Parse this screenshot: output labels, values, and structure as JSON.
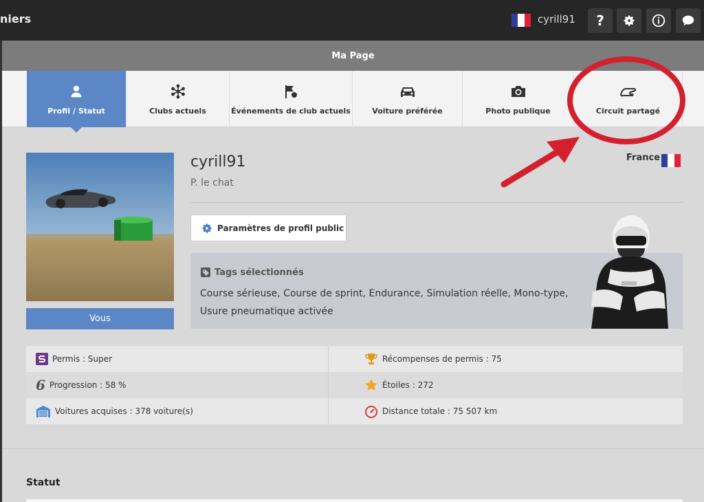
{
  "topbar": {
    "title": "niers",
    "username": "cyrill91",
    "help_label": "?",
    "icons": [
      "flag-fr",
      "help-icon",
      "gear-icon",
      "info-icon",
      "chat-icon"
    ]
  },
  "header": {
    "title": "Ma Page"
  },
  "tabs": [
    {
      "label": "Profil / Statut",
      "icon": "user-icon",
      "active": true
    },
    {
      "label": "Clubs actuels",
      "icon": "clubs-icon",
      "active": false
    },
    {
      "label": "Événements de club actuels",
      "icon": "flag-icon",
      "active": false
    },
    {
      "label": "Voiture préférée",
      "icon": "car-icon",
      "active": false
    },
    {
      "label": "Photo publique",
      "icon": "camera-icon",
      "active": false
    },
    {
      "label": "Circuit partagé",
      "icon": "circuit-icon",
      "active": false
    }
  ],
  "profile": {
    "username": "cyrill91",
    "real_name": "P. le chat",
    "country": "France",
    "avatar_label": "Vous",
    "settings_button": "Paramètres de profil public",
    "tags_title": "Tags sélectionnés",
    "tags_text": "Course sérieuse, Course de sprint, Endurance, Simulation réelle, Mono-type, Usure pneumatique activée"
  },
  "stats": {
    "license": "Permis : Super",
    "license_rewards": "Récompenses de permis : 75",
    "progression": "Progression : 58 %",
    "progression_symbol": "6",
    "stars": "Étoiles : 272",
    "cars": "Voitures acquises : 378 voiture(s)",
    "distance": "Distance totale : 75  507 km"
  },
  "status": {
    "title": "Statut"
  },
  "colors": {
    "accent": "#5b87c6",
    "topbar": "#262626",
    "annotation": "#d3202e",
    "trophy": "#e29a1a",
    "license": "#6a3a88"
  }
}
